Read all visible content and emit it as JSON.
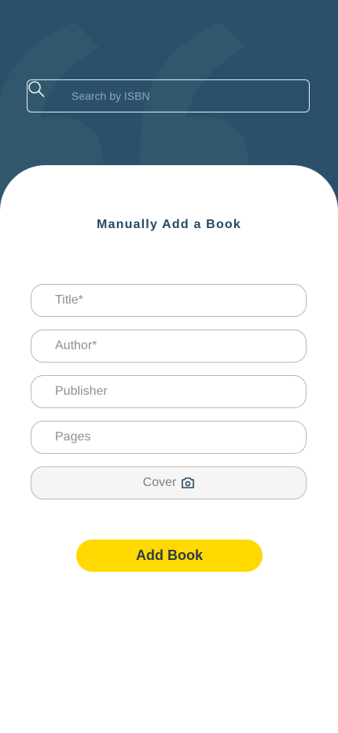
{
  "header": {
    "search": {
      "placeholder": "Search by ISBN",
      "icon": "search-icon"
    },
    "background_color": "#2b5069",
    "watermark": "quote-marks-watermark"
  },
  "form": {
    "title": "Manually Add a Book",
    "fields": [
      {
        "key": "title",
        "placeholder": "Title*"
      },
      {
        "key": "author",
        "placeholder": "Author*"
      },
      {
        "key": "publisher",
        "placeholder": "Publisher"
      },
      {
        "key": "pages",
        "placeholder": "Pages"
      }
    ],
    "cover": {
      "label": "Cover",
      "icon": "camera-icon"
    },
    "submit_label": "Add Book",
    "accent_color": "#ffd900",
    "title_color": "#244a63"
  }
}
